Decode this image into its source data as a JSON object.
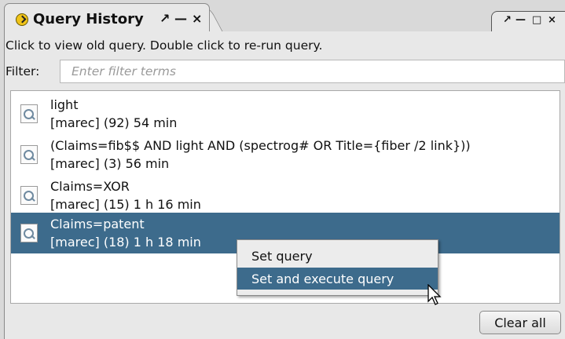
{
  "window": {
    "tab_title": "Query History",
    "tab_controls": [
      "↗",
      "—",
      "×"
    ],
    "mini_tab_controls": [
      "↗",
      "—",
      "□",
      "×"
    ]
  },
  "panel": {
    "hint": "Click to view old query. Double click to re-run query.",
    "filter": {
      "label": "Filter:",
      "value": "",
      "placeholder": "Enter filter terms"
    }
  },
  "history": {
    "items": [
      {
        "query": "light",
        "meta": "[marec] (92) 54 min",
        "selected": false
      },
      {
        "query": "(Claims=fib$$ AND light AND (spectrog# OR Title={fiber /2 link}))",
        "meta": "[marec] (3) 56 min",
        "selected": false
      },
      {
        "query": "Claims=XOR",
        "meta": "[marec] (15) 1 h 16 min",
        "selected": false
      },
      {
        "query": "Claims=patent",
        "meta": "[marec] (18) 1 h 18 min",
        "selected": true
      }
    ]
  },
  "context_menu": {
    "items": [
      {
        "label": "Set query",
        "highlighted": false
      },
      {
        "label": "Set and execute query",
        "highlighted": true
      }
    ]
  },
  "buttons": {
    "clear_all": "Clear all"
  },
  "colors": {
    "selection": "#3d6b8c",
    "panel_bg": "#e8e8e8"
  }
}
